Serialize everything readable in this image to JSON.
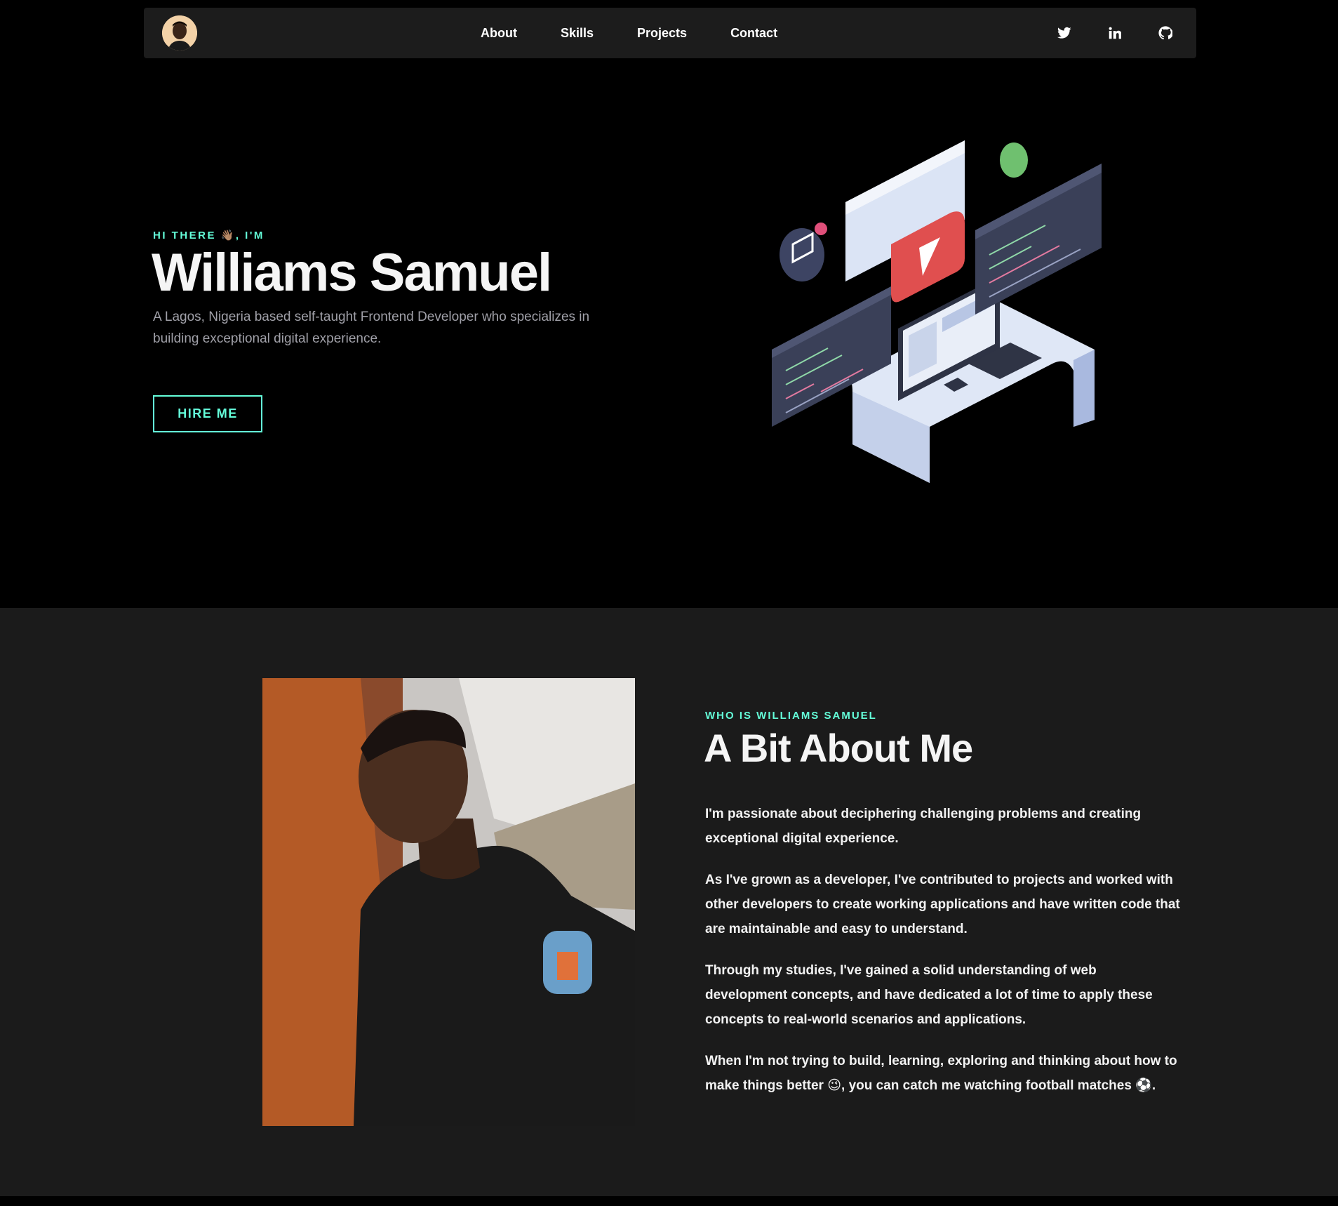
{
  "nav": {
    "links": [
      "About",
      "Skills",
      "Projects",
      "Contact"
    ],
    "social_icons": [
      "twitter-icon",
      "linkedin-icon",
      "github-icon"
    ]
  },
  "hero": {
    "kicker": "HI THERE 👋🏽, I'M",
    "name": "Williams Samuel",
    "description": "A Lagos, Nigeria based self-taught Frontend Developer who specializes in building exceptional digital experience.",
    "cta": "HIRE ME"
  },
  "about": {
    "kicker": "WHO IS WILLIAMS SAMUEL",
    "title": "A Bit About Me",
    "paragraphs": [
      "I'm passionate about deciphering challenging problems and creating exceptional digital experience.",
      "As I've grown as a developer, I've contributed to projects and worked with other developers to create working applications and have written code that are maintainable and easy to understand.",
      "Through my studies, I've gained a solid understanding of web development concepts, and have dedicated a lot of time to apply these concepts to real-world scenarios and applications.",
      "When I'm not trying to build, learning, exploring and thinking about how to make things better 😉, you can catch me watching football matches ⚽."
    ]
  },
  "colors": {
    "accent": "#64ffda",
    "nav_bg": "#1c1c1c",
    "hero_bg": "#000000",
    "about_bg": "#1b1b1b"
  }
}
